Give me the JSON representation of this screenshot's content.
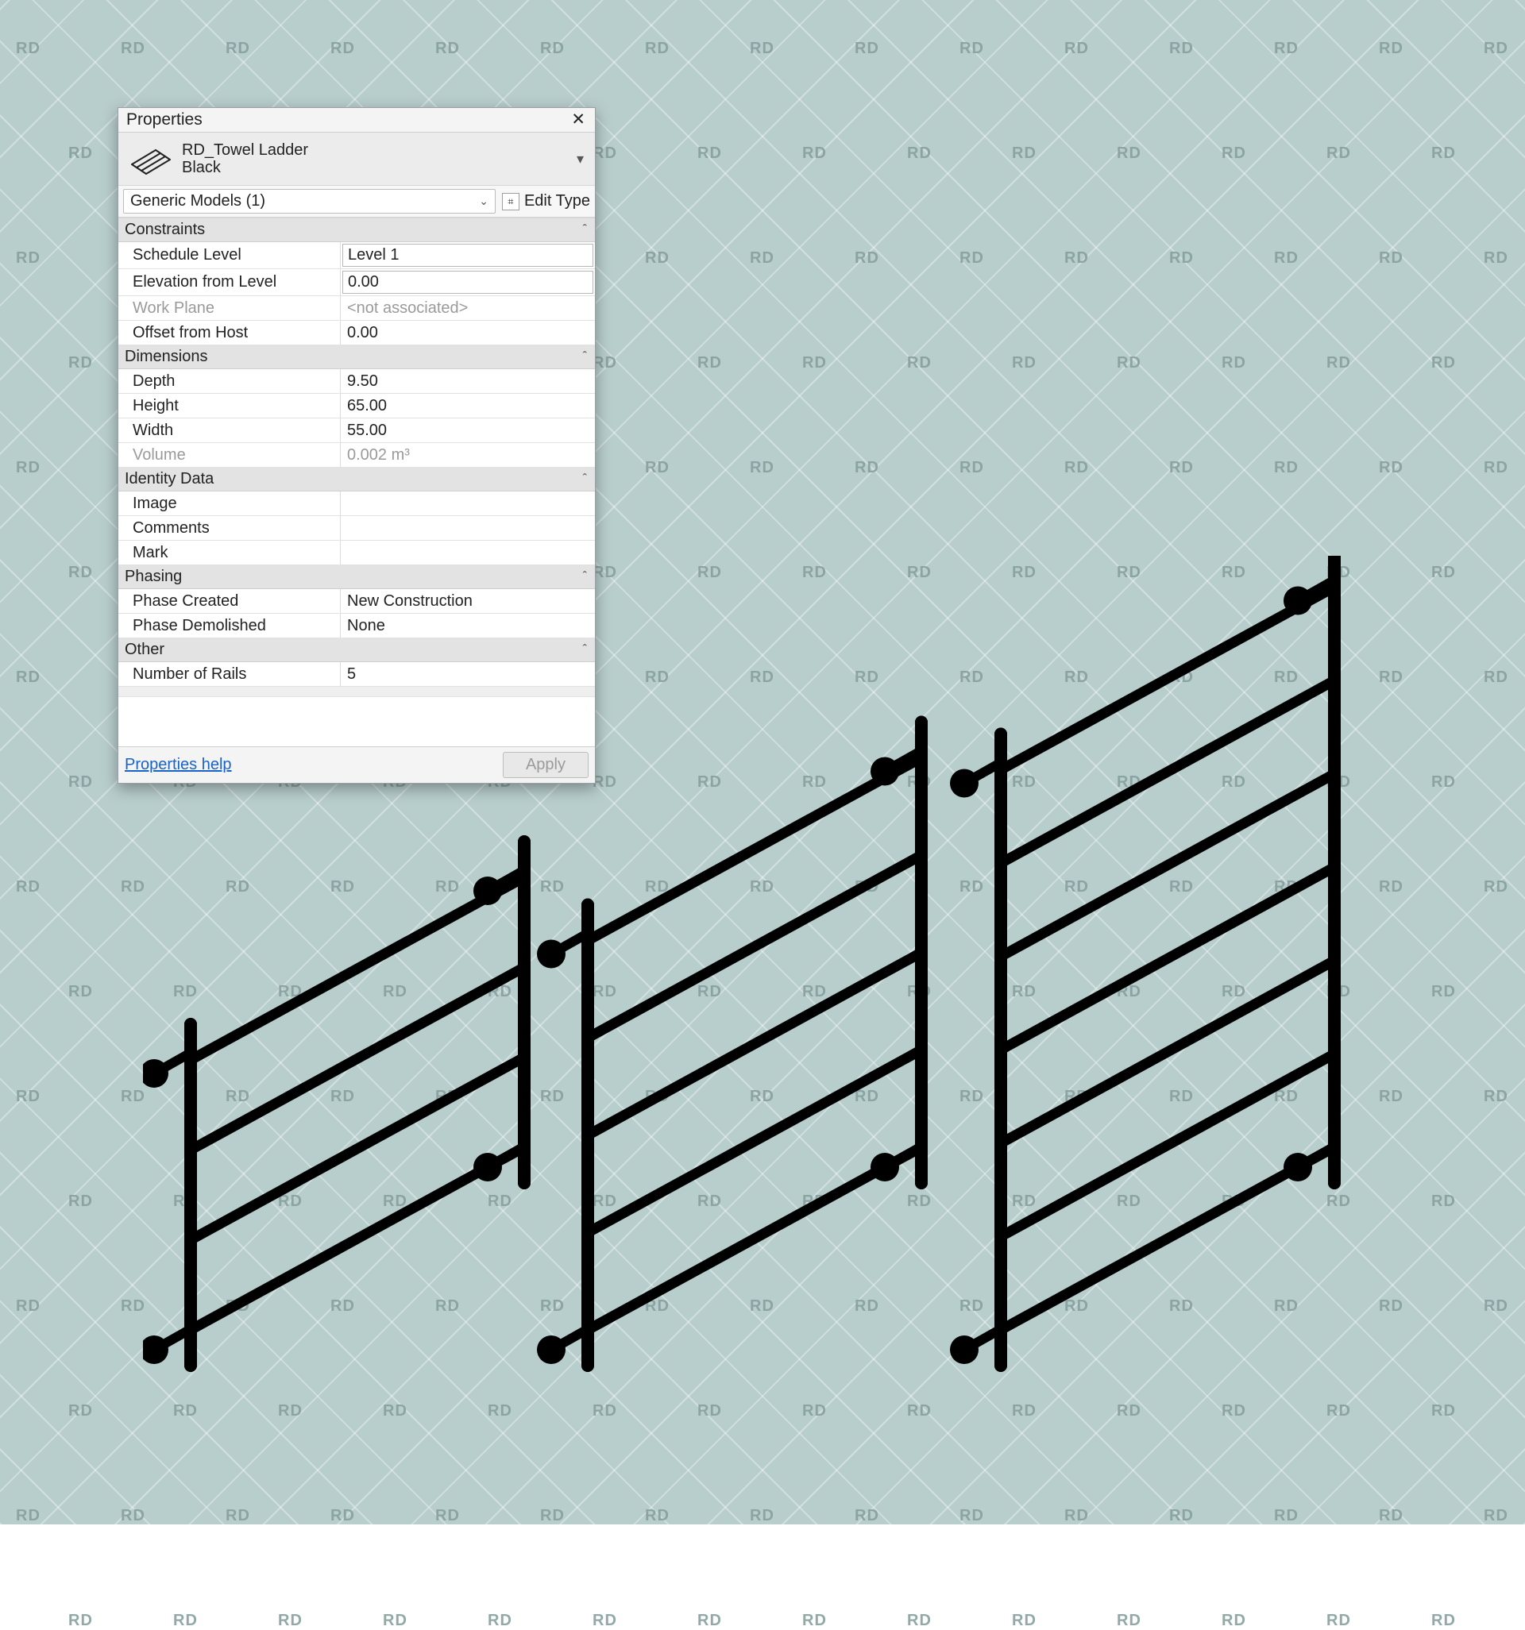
{
  "watermark_text": "RD",
  "panel": {
    "title": "Properties",
    "type_name_line1": "RD_Towel Ladder",
    "type_name_line2": "Black",
    "category_selector": "Generic Models (1)",
    "edit_type_label": "Edit Type",
    "groups": [
      {
        "title": "Constraints",
        "rows": [
          {
            "label": "Schedule Level",
            "value": "Level 1",
            "boxed": true,
            "editable": true
          },
          {
            "label": "Elevation from Level",
            "value": "0.00",
            "boxed": true,
            "editable": true
          },
          {
            "label": "Work Plane",
            "value": "<not associated>",
            "disabled": true
          },
          {
            "label": "Offset from Host",
            "value": "0.00",
            "editable": true
          }
        ]
      },
      {
        "title": "Dimensions",
        "rows": [
          {
            "label": "Depth",
            "value": "9.50",
            "editable": true,
            "has_button": true
          },
          {
            "label": "Height",
            "value": "65.00",
            "editable": true,
            "has_button": true
          },
          {
            "label": "Width",
            "value": "55.00",
            "editable": true,
            "has_button": true
          },
          {
            "label": "Volume",
            "value": "0.002 m³",
            "disabled": true
          }
        ]
      },
      {
        "title": "Identity Data",
        "rows": [
          {
            "label": "Image",
            "value": "",
            "editable": true
          },
          {
            "label": "Comments",
            "value": "",
            "editable": true
          },
          {
            "label": "Mark",
            "value": "",
            "editable": true
          }
        ]
      },
      {
        "title": "Phasing",
        "rows": [
          {
            "label": "Phase Created",
            "value": "New Construction",
            "editable": true,
            "has_button": true
          },
          {
            "label": "Phase Demolished",
            "value": "None",
            "editable": true,
            "has_button": true
          }
        ]
      },
      {
        "title": "Other",
        "rows": [
          {
            "label": "Number of Rails",
            "value": "5",
            "editable": true,
            "has_button": true
          }
        ]
      }
    ],
    "help_label": "Properties help",
    "apply_label": "Apply"
  },
  "ladders": [
    {
      "rails": 4,
      "height_scale": 1.0
    },
    {
      "rails": 5,
      "height_scale": 1.35
    },
    {
      "rails": 7,
      "height_scale": 1.85
    }
  ]
}
